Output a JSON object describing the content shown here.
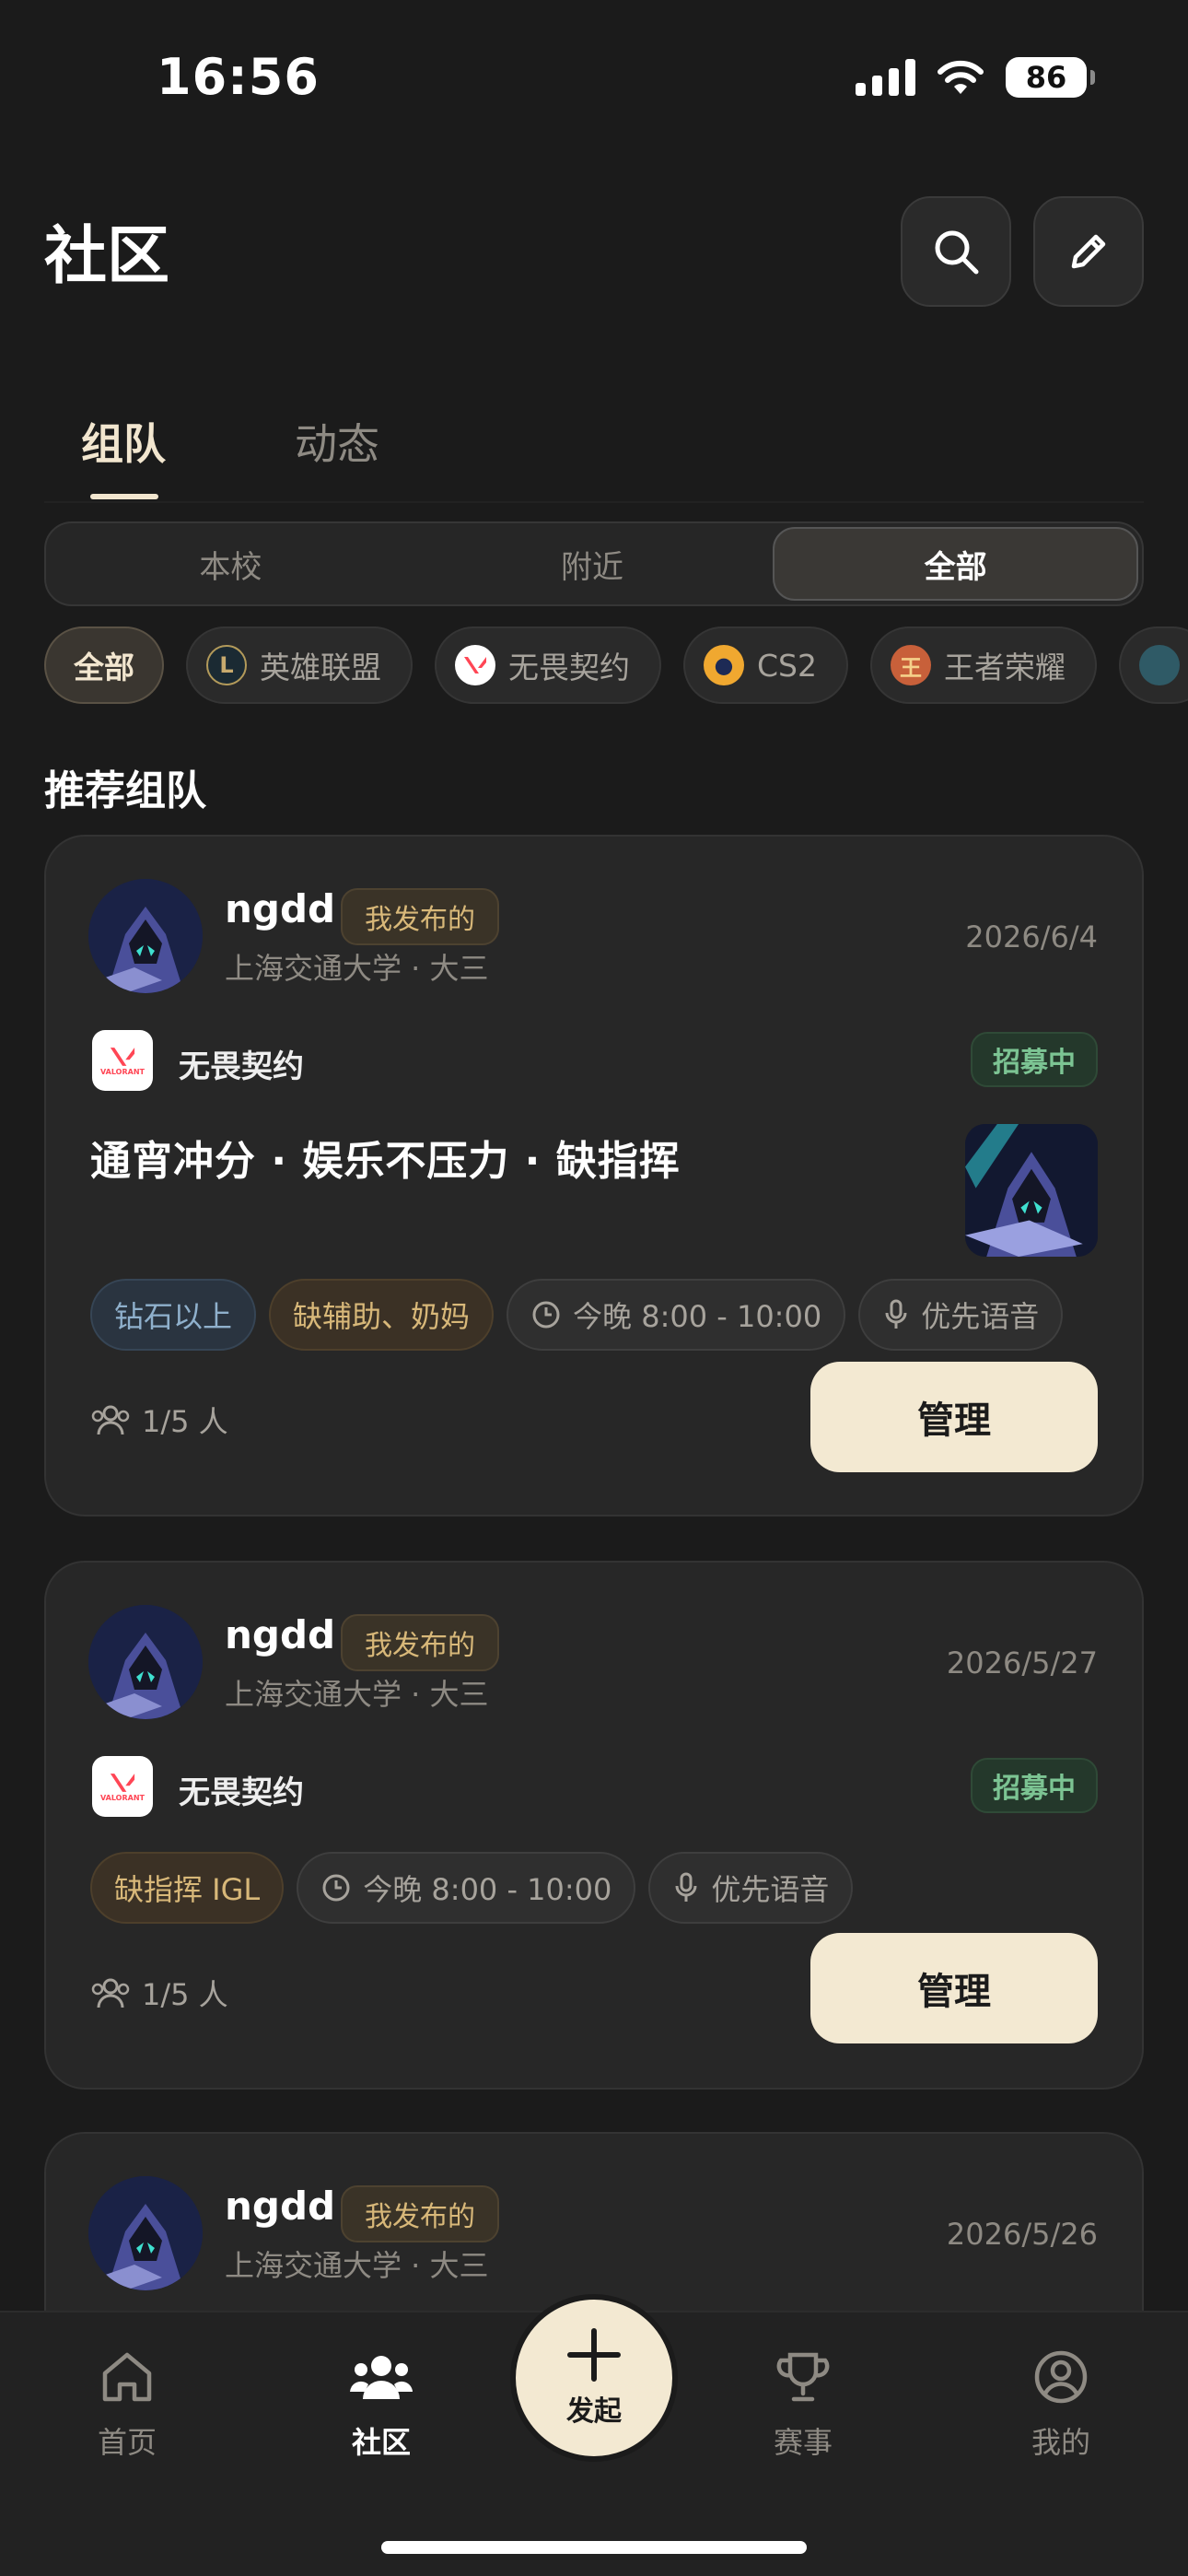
{
  "status_bar": {
    "time": "16:56",
    "battery": "86"
  },
  "header": {
    "title": "社区"
  },
  "main_tabs": [
    {
      "label": "组队"
    },
    {
      "label": "动态"
    }
  ],
  "scope_tabs": [
    {
      "label": "本校"
    },
    {
      "label": "附近"
    },
    {
      "label": "全部"
    }
  ],
  "game_filters": [
    {
      "label": "全部"
    },
    {
      "label": "英雄联盟"
    },
    {
      "label": "无畏契约"
    },
    {
      "label": "CS2"
    },
    {
      "label": "王者荣耀"
    }
  ],
  "section_title": "推荐组队",
  "posts": [
    {
      "username": "ngdd",
      "badge": "我发布的",
      "school": "上海交通大学 · 大三",
      "date": "2026/6/4",
      "game": "无畏契约",
      "game_logo_text": "VALORANT",
      "status": "招募中",
      "title": "通宵冲分 · 娱乐不压力 · 缺指挥",
      "tags": [
        "钻石以上",
        "缺辅助、奶妈",
        "今晚 8:00 - 10:00",
        "优先语音"
      ],
      "members": "1/5 人",
      "action": "管理"
    },
    {
      "username": "ngdd",
      "badge": "我发布的",
      "school": "上海交通大学 · 大三",
      "date": "2026/5/27",
      "game": "无畏契约",
      "game_logo_text": "VALORANT",
      "status": "招募中",
      "tags": [
        "缺指挥 IGL",
        "今晚 8:00 - 10:00",
        "优先语音"
      ],
      "members": "1/5 人",
      "action": "管理"
    },
    {
      "username": "ngdd",
      "badge": "我发布的",
      "school": "上海交通大学 · 大三",
      "date": "2026/5/26"
    }
  ],
  "bottom_nav": {
    "items": [
      {
        "label": "首页",
        "icon": "home-icon"
      },
      {
        "label": "社区",
        "icon": "community-icon"
      },
      {
        "label": "赛事",
        "icon": "trophy-icon"
      },
      {
        "label": "我的",
        "icon": "profile-icon"
      }
    ],
    "fab_label": "发起"
  },
  "colors": {
    "accent": "#f3e9d2",
    "background": "#1b1b1b",
    "card": "#272727",
    "recruit_green": "#7cc493",
    "gold": "#d8b879"
  }
}
